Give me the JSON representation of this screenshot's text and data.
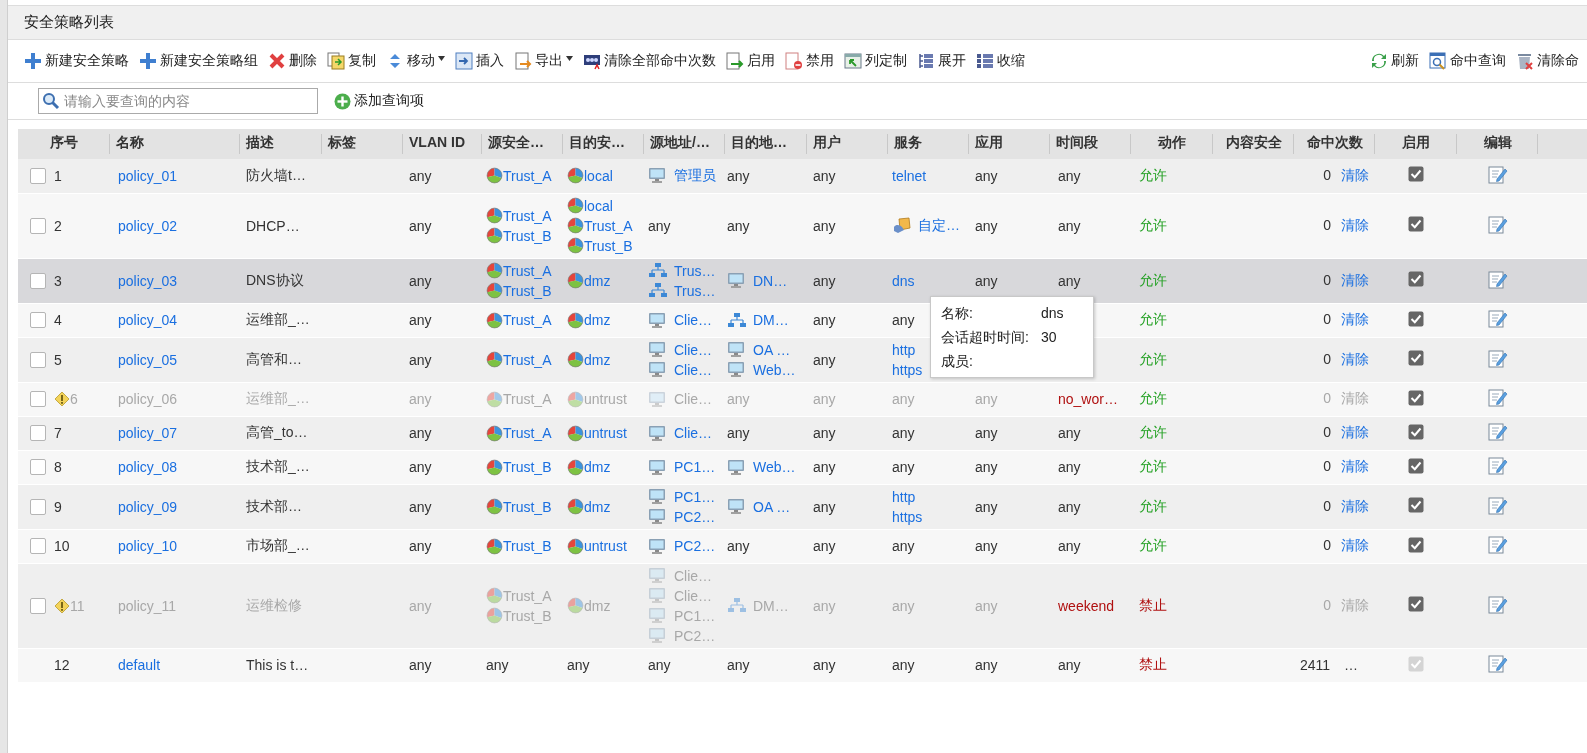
{
  "title": "安全策略列表",
  "toolbar": {
    "left": [
      {
        "label": "新建安全策略",
        "kind": "add",
        "dropdown": false
      },
      {
        "label": "新建安全策略组",
        "kind": "add",
        "dropdown": false
      },
      {
        "label": "删除",
        "kind": "delete",
        "dropdown": false
      },
      {
        "label": "复制",
        "kind": "copy",
        "dropdown": false
      },
      {
        "label": "移动",
        "kind": "move",
        "dropdown": true
      },
      {
        "label": "插入",
        "kind": "insert",
        "dropdown": false
      },
      {
        "label": "导出",
        "kind": "export",
        "dropdown": true
      },
      {
        "label": "清除全部命中次数",
        "kind": "counter",
        "dropdown": false
      },
      {
        "label": "启用",
        "kind": "enable",
        "dropdown": false
      },
      {
        "label": "禁用",
        "kind": "disable",
        "dropdown": false
      },
      {
        "label": "列定制",
        "kind": "columns",
        "dropdown": false
      },
      {
        "label": "展开",
        "kind": "expand",
        "dropdown": false
      },
      {
        "label": "收缩",
        "kind": "collapse",
        "dropdown": false
      }
    ],
    "right": [
      {
        "label": "刷新",
        "kind": "refresh",
        "dropdown": false
      },
      {
        "label": "命中查询",
        "kind": "query",
        "dropdown": false
      },
      {
        "label": "清除命",
        "kind": "clear",
        "dropdown": false
      }
    ]
  },
  "search": {
    "placeholder": "请输入要查询的内容",
    "add_label": "添加查询项"
  },
  "columns": [
    "序号",
    "名称",
    "描述",
    "标签",
    "VLAN ID",
    "源安全…",
    "目的安…",
    "源地址/…",
    "目的地…",
    "用户",
    "服务",
    "应用",
    "时间段",
    "动作",
    "内容安全",
    "命中次数",
    "启用",
    "编辑"
  ],
  "rows": [
    {
      "kind": "policy",
      "selected": false,
      "checked": false,
      "warning": false,
      "disabled": false,
      "no": "1",
      "name": "policy_01",
      "description": "防火墙t…",
      "vlan": "any",
      "src_zone": [
        {
          "kind": "zone",
          "text": "Trust_A"
        }
      ],
      "dst_zone": [
        {
          "kind": "zone",
          "text": "local"
        }
      ],
      "src_addr": [
        {
          "kind": "host",
          "text": "管理员"
        }
      ],
      "dst_addr": [
        {
          "kind": "plain",
          "text": "any"
        }
      ],
      "user": "any",
      "service": [
        {
          "kind": "link",
          "text": "telnet"
        }
      ],
      "app": "any",
      "time": {
        "kind": "plain",
        "text": "any"
      },
      "action": {
        "kind": "allow",
        "text": "允许"
      },
      "hits": "0",
      "clear": "清除",
      "enabled": true
    },
    {
      "kind": "policy",
      "selected": false,
      "checked": false,
      "warning": false,
      "disabled": false,
      "no": "2",
      "name": "policy_02",
      "description": "DHCP…",
      "vlan": "any",
      "src_zone": [
        {
          "kind": "zone",
          "text": "Trust_A"
        },
        {
          "kind": "zone",
          "text": "Trust_B"
        }
      ],
      "dst_zone": [
        {
          "kind": "zone",
          "text": "local"
        },
        {
          "kind": "zone",
          "text": "Trust_A"
        },
        {
          "kind": "zone",
          "text": "Trust_B"
        }
      ],
      "src_addr": [
        {
          "kind": "plain",
          "text": "any"
        }
      ],
      "dst_addr": [
        {
          "kind": "plain",
          "text": "any"
        }
      ],
      "user": "any",
      "service": [
        {
          "kind": "custom",
          "text": "自定…"
        }
      ],
      "app": "any",
      "time": {
        "kind": "plain",
        "text": "any"
      },
      "action": {
        "kind": "allow",
        "text": "允许"
      },
      "hits": "0",
      "clear": "清除",
      "enabled": true
    },
    {
      "kind": "policy",
      "selected": true,
      "checked": false,
      "warning": false,
      "disabled": false,
      "no": "3",
      "name": "policy_03",
      "description": "DNS协议",
      "vlan": "any",
      "src_zone": [
        {
          "kind": "zone",
          "text": "Trust_A"
        },
        {
          "kind": "zone",
          "text": "Trust_B"
        }
      ],
      "dst_zone": [
        {
          "kind": "zone",
          "text": "dmz"
        }
      ],
      "src_addr": [
        {
          "kind": "net",
          "text": "Trus…"
        },
        {
          "kind": "net",
          "text": "Trus…"
        }
      ],
      "dst_addr": [
        {
          "kind": "host",
          "text": "DN…"
        }
      ],
      "user": "any",
      "service": [
        {
          "kind": "link",
          "text": "dns"
        }
      ],
      "app": "any",
      "time": {
        "kind": "plain",
        "text": "any"
      },
      "action": {
        "kind": "allow",
        "text": "允许"
      },
      "hits": "0",
      "clear": "清除",
      "enabled": true
    },
    {
      "kind": "policy",
      "selected": false,
      "checked": false,
      "warning": false,
      "disabled": false,
      "no": "4",
      "name": "policy_04",
      "description": "运维部_…",
      "vlan": "any",
      "src_zone": [
        {
          "kind": "zone",
          "text": "Trust_A"
        }
      ],
      "dst_zone": [
        {
          "kind": "zone",
          "text": "dmz"
        }
      ],
      "src_addr": [
        {
          "kind": "host",
          "text": "Clie…"
        }
      ],
      "dst_addr": [
        {
          "kind": "net",
          "text": "DM…"
        }
      ],
      "user": "any",
      "service": [
        {
          "kind": "plain",
          "text": "any"
        }
      ],
      "action": {
        "kind": "allow",
        "text": "允许"
      },
      "hits": "0",
      "clear": "清除",
      "enabled": true
    },
    {
      "kind": "policy",
      "selected": false,
      "checked": false,
      "warning": false,
      "disabled": false,
      "no": "5",
      "name": "policy_05",
      "description": "高管和…",
      "vlan": "any",
      "src_zone": [
        {
          "kind": "zone",
          "text": "Trust_A"
        }
      ],
      "dst_zone": [
        {
          "kind": "zone",
          "text": "dmz"
        }
      ],
      "src_addr": [
        {
          "kind": "host",
          "text": "Clie…"
        },
        {
          "kind": "host",
          "text": "Clie…"
        }
      ],
      "dst_addr": [
        {
          "kind": "host",
          "text": "OA …"
        },
        {
          "kind": "host",
          "text": "Web…"
        }
      ],
      "user": "any",
      "service": [
        {
          "kind": "link",
          "text": "http"
        },
        {
          "kind": "link",
          "text": "https"
        }
      ],
      "action": {
        "kind": "allow",
        "text": "允许"
      },
      "hits": "0",
      "clear": "清除",
      "enabled": true
    },
    {
      "kind": "policy",
      "selected": false,
      "checked": false,
      "warning": true,
      "disabled": true,
      "no": "6",
      "name": "policy_06",
      "description": "运维部_…",
      "vlan": "any",
      "src_zone": [
        {
          "kind": "zone",
          "text": "Trust_A"
        }
      ],
      "dst_zone": [
        {
          "kind": "zone",
          "text": "untrust"
        }
      ],
      "src_addr": [
        {
          "kind": "host",
          "text": "Clie…"
        }
      ],
      "dst_addr": [
        {
          "kind": "plain",
          "text": "any"
        }
      ],
      "user": "any",
      "service": [
        {
          "kind": "plain",
          "text": "any"
        }
      ],
      "app": "any",
      "time": {
        "kind": "schedule",
        "text": "no_wor…"
      },
      "action": {
        "kind": "allow",
        "text": "允许"
      },
      "hits": "0",
      "clear": "清除",
      "enabled": true
    },
    {
      "kind": "policy",
      "selected": false,
      "checked": false,
      "warning": false,
      "disabled": false,
      "no": "7",
      "name": "policy_07",
      "description": "高管_to…",
      "vlan": "any",
      "src_zone": [
        {
          "kind": "zone",
          "text": "Trust_A"
        }
      ],
      "dst_zone": [
        {
          "kind": "zone",
          "text": "untrust"
        }
      ],
      "src_addr": [
        {
          "kind": "host",
          "text": "Clie…"
        }
      ],
      "dst_addr": [
        {
          "kind": "plain",
          "text": "any"
        }
      ],
      "user": "any",
      "service": [
        {
          "kind": "plain",
          "text": "any"
        }
      ],
      "app": "any",
      "time": {
        "kind": "plain",
        "text": "any"
      },
      "action": {
        "kind": "allow",
        "text": "允许"
      },
      "hits": "0",
      "clear": "清除",
      "enabled": true
    },
    {
      "kind": "policy",
      "selected": false,
      "checked": false,
      "warning": false,
      "disabled": false,
      "no": "8",
      "name": "policy_08",
      "description": "技术部_…",
      "vlan": "any",
      "src_zone": [
        {
          "kind": "zone",
          "text": "Trust_B"
        }
      ],
      "dst_zone": [
        {
          "kind": "zone",
          "text": "dmz"
        }
      ],
      "src_addr": [
        {
          "kind": "host",
          "text": "PC1…"
        }
      ],
      "dst_addr": [
        {
          "kind": "host",
          "text": "Web…"
        }
      ],
      "user": "any",
      "service": [
        {
          "kind": "plain",
          "text": "any"
        }
      ],
      "app": "any",
      "time": {
        "kind": "plain",
        "text": "any"
      },
      "action": {
        "kind": "allow",
        "text": "允许"
      },
      "hits": "0",
      "clear": "清除",
      "enabled": true
    },
    {
      "kind": "policy",
      "selected": false,
      "checked": false,
      "warning": false,
      "disabled": false,
      "no": "9",
      "name": "policy_09",
      "description": "技术部…",
      "vlan": "any",
      "src_zone": [
        {
          "kind": "zone",
          "text": "Trust_B"
        }
      ],
      "dst_zone": [
        {
          "kind": "zone",
          "text": "dmz"
        }
      ],
      "src_addr": [
        {
          "kind": "host",
          "text": "PC1…"
        },
        {
          "kind": "host",
          "text": "PC2…"
        }
      ],
      "dst_addr": [
        {
          "kind": "host",
          "text": "OA …"
        }
      ],
      "user": "any",
      "service": [
        {
          "kind": "link",
          "text": "http"
        },
        {
          "kind": "link",
          "text": "https"
        }
      ],
      "app": "any",
      "time": {
        "kind": "plain",
        "text": "any"
      },
      "action": {
        "kind": "allow",
        "text": "允许"
      },
      "hits": "0",
      "clear": "清除",
      "enabled": true
    },
    {
      "kind": "policy",
      "selected": false,
      "checked": false,
      "warning": false,
      "disabled": false,
      "no": "10",
      "name": "policy_10",
      "description": "市场部_…",
      "vlan": "any",
      "src_zone": [
        {
          "kind": "zone",
          "text": "Trust_B"
        }
      ],
      "dst_zone": [
        {
          "kind": "zone",
          "text": "untrust"
        }
      ],
      "src_addr": [
        {
          "kind": "host",
          "text": "PC2…"
        }
      ],
      "dst_addr": [
        {
          "kind": "plain",
          "text": "any"
        }
      ],
      "user": "any",
      "service": [
        {
          "kind": "plain",
          "text": "any"
        }
      ],
      "app": "any",
      "time": {
        "kind": "plain",
        "text": "any"
      },
      "action": {
        "kind": "allow",
        "text": "允许"
      },
      "hits": "0",
      "clear": "清除",
      "enabled": true
    },
    {
      "kind": "policy",
      "selected": false,
      "checked": false,
      "warning": true,
      "disabled": true,
      "no": "11",
      "name": "policy_11",
      "description": "运维检修",
      "vlan": "any",
      "src_zone": [
        {
          "kind": "zone",
          "text": "Trust_A"
        },
        {
          "kind": "zone",
          "text": "Trust_B"
        }
      ],
      "dst_zone": [
        {
          "kind": "zone",
          "text": "dmz"
        }
      ],
      "src_addr": [
        {
          "kind": "host",
          "text": "Clie…"
        },
        {
          "kind": "host",
          "text": "Clie…"
        },
        {
          "kind": "host",
          "text": "PC1…"
        },
        {
          "kind": "host",
          "text": "PC2…"
        }
      ],
      "dst_addr": [
        {
          "kind": "net",
          "text": "DM…"
        }
      ],
      "user": "any",
      "service": [
        {
          "kind": "plain",
          "text": "any"
        }
      ],
      "app": "any",
      "time": {
        "kind": "schedule",
        "text": "weekend"
      },
      "action": {
        "kind": "deny",
        "text": "禁止"
      },
      "hits": "0",
      "clear": "清除",
      "enabled": true
    },
    {
      "kind": "default",
      "selected": false,
      "warning": false,
      "disabled": false,
      "no": "12",
      "name": "default",
      "description": "This is t…",
      "vlan": "any",
      "src_zone": [
        {
          "kind": "plain",
          "text": "any"
        }
      ],
      "dst_zone": [
        {
          "kind": "plain",
          "text": "any"
        }
      ],
      "src_addr": [
        {
          "kind": "plain",
          "text": "any"
        }
      ],
      "dst_addr": [
        {
          "kind": "plain",
          "text": "any"
        }
      ],
      "user": "any",
      "service": [
        {
          "kind": "plain",
          "text": "any"
        }
      ],
      "app": "any",
      "time": {
        "kind": "plain",
        "text": "any"
      },
      "action": {
        "kind": "deny",
        "text": "禁止"
      },
      "hits": "2411",
      "clear": "…",
      "enabled": true
    }
  ],
  "tooltip": {
    "rows": [
      {
        "label": "名称:",
        "value": "dns"
      },
      {
        "label": "会话超时时间:",
        "value": "30"
      },
      {
        "label": "成员:"
      }
    ]
  }
}
